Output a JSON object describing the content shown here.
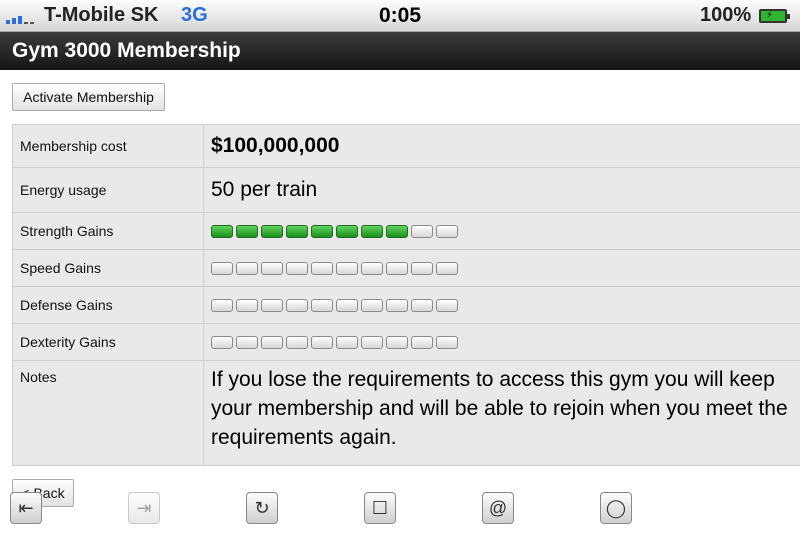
{
  "status_bar": {
    "carrier": "T-Mobile SK",
    "network": "3G",
    "time": "0:05",
    "battery": "100%",
    "signal_bars": 5
  },
  "header": {
    "title": "Gym 3000 Membership"
  },
  "actions": {
    "activate_label": "Activate Membership",
    "back_label": "< Back"
  },
  "details": {
    "cost_label": "Membership cost",
    "cost_value": "$100,000,000",
    "energy_label": "Energy usage",
    "energy_value": "50 per train",
    "notes_label": "Notes",
    "notes_value": "If you lose the requirements to access this gym you will keep your membership and will be able to rejoin when you meet the requirements again."
  },
  "gains": [
    {
      "label": "Strength Gains",
      "filled": 8,
      "total": 10
    },
    {
      "label": "Speed Gains",
      "filled": 0,
      "total": 10
    },
    {
      "label": "Defense Gains",
      "filled": 0,
      "total": 10
    },
    {
      "label": "Dexterity Gains",
      "filled": 0,
      "total": 10
    }
  ],
  "toolbar": [
    {
      "icon": "back-arrow-icon",
      "glyph": "⇤",
      "enabled": true
    },
    {
      "icon": "forward-arrow-icon",
      "glyph": "⇥",
      "enabled": false
    },
    {
      "icon": "reload-icon",
      "glyph": "↻",
      "enabled": true
    },
    {
      "icon": "window-icon",
      "glyph": "☐",
      "enabled": true
    },
    {
      "icon": "at-icon",
      "glyph": "@",
      "enabled": true
    },
    {
      "icon": "circle-icon",
      "glyph": "◯",
      "enabled": true
    }
  ],
  "colors": {
    "bar_filled": "#1b8f1b",
    "network": "#2a6fd6"
  }
}
